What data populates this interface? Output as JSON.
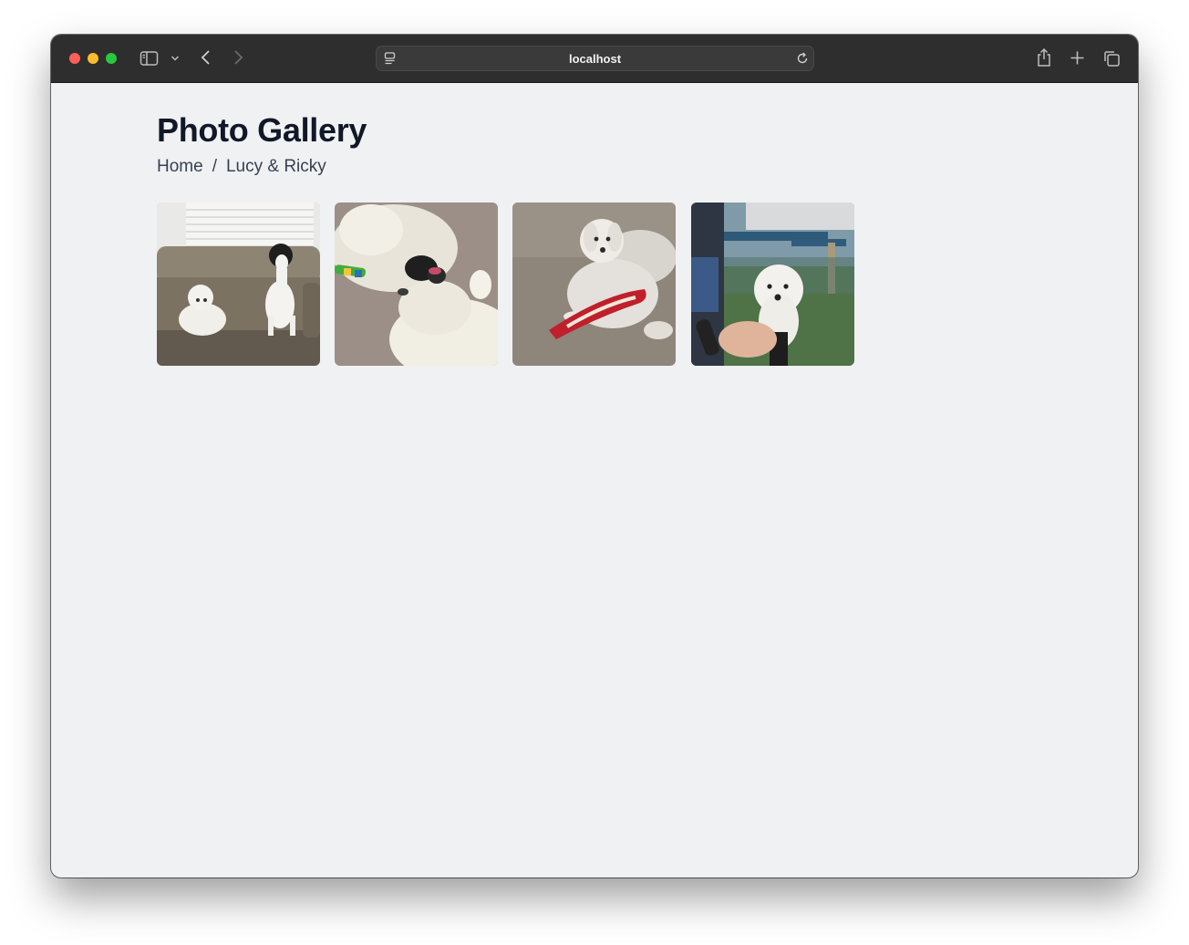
{
  "browser": {
    "url": "localhost"
  },
  "page": {
    "title": "Photo Gallery",
    "breadcrumb": {
      "home": "Home",
      "separator": "/",
      "current": "Lucy & Ricky"
    }
  },
  "gallery": {
    "photos": [
      {
        "name": "photo-two-dogs-on-couch"
      },
      {
        "name": "photo-dogs-playing-on-carpet"
      },
      {
        "name": "photo-dog-with-red-toy"
      },
      {
        "name": "photo-dog-getting-treat"
      }
    ]
  },
  "colors": {
    "toolbar": "#2e2e2e",
    "page_background": "#f0f1f3",
    "title": "#111827",
    "breadcrumb": "#374151"
  }
}
